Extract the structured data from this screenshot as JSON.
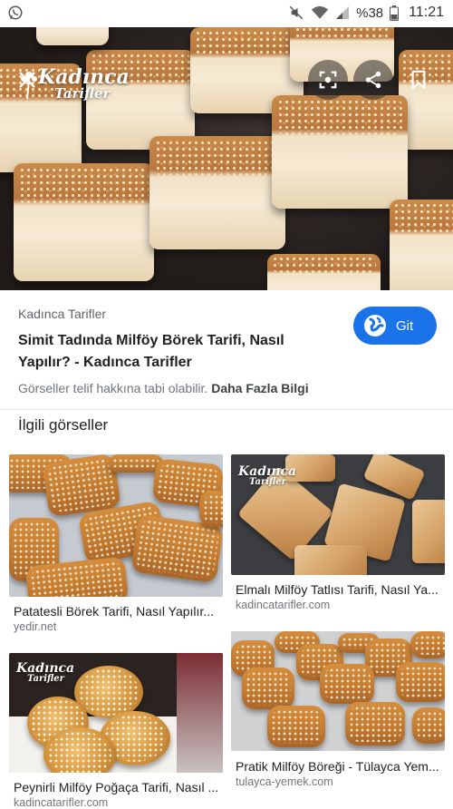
{
  "status_bar": {
    "battery_percent": "%38",
    "time": "11:21",
    "icons": [
      "whatsapp-icon",
      "mute-icon",
      "wifi-icon",
      "signal-icon",
      "battery-icon"
    ]
  },
  "hero": {
    "logo_line1": "Kadınca",
    "logo_line2": "Tarifler",
    "icons": [
      "close-icon",
      "lens-icon",
      "share-icon",
      "bookmark-icon"
    ]
  },
  "result": {
    "source": "Kadınca Tarifler",
    "title": "Simit Tadında Milföy Börek Tarifi, Nasıl Yapılır? - Kadınca Tarifler",
    "visit_label": "Git",
    "copyright_text": "Görseller telif hakkına tabi olabilir.",
    "more_info_label": "Daha Fazla Bilgi"
  },
  "related": {
    "heading": "İlgili görseller",
    "items": [
      {
        "title": "Patatesli Börek Tarifi, Nasıl Yapılır...",
        "source": "yedir.net"
      },
      {
        "title": "Elmalı Milföy Tatlısı Tarifi, Nasıl Ya...",
        "source": "kadincatarifler.com",
        "logo_line1": "Kadınca",
        "logo_line2": "Tarifler"
      },
      {
        "title": "Peynirli Milföy Poğaça Tarifi, Nasıl ...",
        "source": "kadincatarifler.com",
        "logo_line1": "Kadınca",
        "logo_line2": "Tarifler"
      },
      {
        "title": "Pratik Milföy Böreği - Tülayca Yem...",
        "source": "tulayca-yemek.com"
      }
    ]
  },
  "colors": {
    "accent": "#1a73e8",
    "text_primary": "#202124",
    "text_secondary": "#70757a"
  }
}
